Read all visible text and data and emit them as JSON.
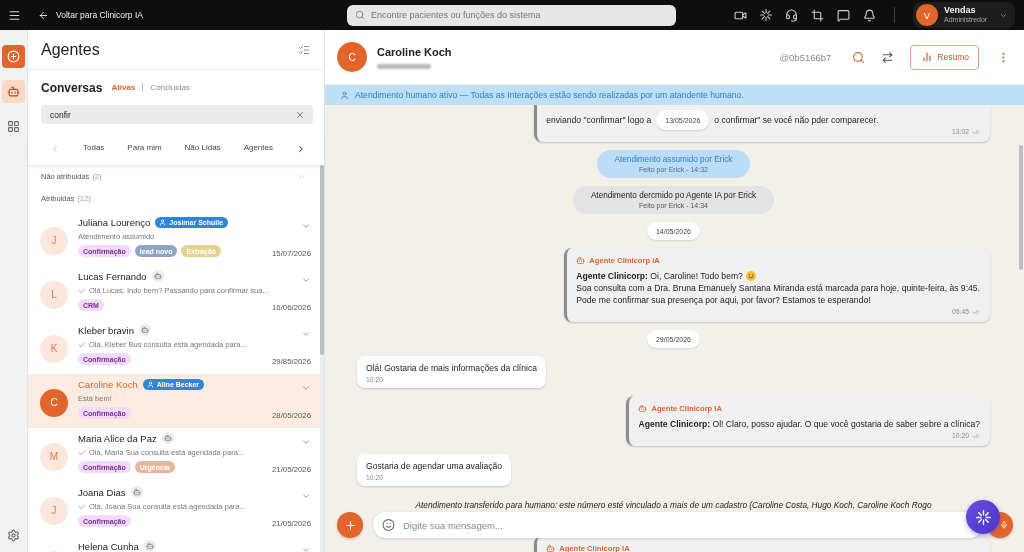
{
  "topbar": {
    "back_label": "Voltar para Clinicorp IA",
    "search": {
      "placeholder": "Encontre pacientes ou funções do sistema"
    },
    "user": {
      "initial": "V",
      "name": "Vendas",
      "role": "Administredor"
    }
  },
  "rail": {
    "nav": [
      {
        "kind": "agents",
        "selected": true
      },
      {
        "kind": "apps",
        "selected": false
      }
    ]
  },
  "panel": {
    "title": "Agentes",
    "section": "Conversas",
    "status_filters": [
      {
        "label": "Ativas",
        "selected": true
      },
      {
        "label": "Concluidas",
        "selected": false
      }
    ],
    "search": {
      "value": "confir"
    },
    "pager": {
      "prev_disabled": true,
      "next_disabled": false
    },
    "tabs": [
      {
        "label": "Todas",
        "selected": false
      },
      {
        "label": "Para mim",
        "selected": false
      },
      {
        "label": "Não Lidas",
        "selected": false
      },
      {
        "label": "Agentes",
        "selected": false
      }
    ],
    "groups": [
      {
        "label": "Não atribuidas",
        "count": "(2)",
        "collapsed": true
      },
      {
        "label": "Atribuidas",
        "count": "(12)"
      }
    ],
    "conversations": [
      {
        "initial": "J",
        "name": "Juliana Lourenço",
        "assignee": "Josimar Schulle",
        "preview": "Atendimento assumido",
        "sent": false,
        "tags": [
          {
            "label": "Confirmação",
            "color": "#f1dcf8"
          },
          {
            "label": "lead novo",
            "color": "#8ca4c6"
          },
          {
            "label": "Extração",
            "color": "#e2d48c"
          }
        ],
        "date": "15/07/2026",
        "selected": false
      },
      {
        "initial": "L",
        "name": "Lucas Fernando",
        "preview": "Olá Lucas, Indo bem? Passando para confirmar sua...",
        "sent": true,
        "tags": [
          {
            "label": "CRM",
            "color": "#f1dcf8"
          }
        ],
        "date": "16/06/2026",
        "selected": false
      },
      {
        "initial": "K",
        "name": "Kleber bravin",
        "preview": "Olá, Kleber Bus consulta está agendada para...",
        "sent": true,
        "tags": [
          {
            "label": "Confirmação",
            "color": "#f1dcf8"
          }
        ],
        "date": "29/85/2026",
        "selected": false
      },
      {
        "initial": "C",
        "name": "Caroline Koch",
        "assignee": "Aline Becker",
        "preview": "Está bem!",
        "sent": false,
        "tags": [
          {
            "label": "Confirmação",
            "color": "#f1dcf8"
          }
        ],
        "date": "28/05/2026",
        "selected": true
      },
      {
        "initial": "M",
        "name": "Maria Alice da Paz",
        "preview": "Olá, Maria Sua consulta está agendada para...",
        "sent": true,
        "tags": [
          {
            "label": "Confirmação",
            "color": "#f1dcf8"
          },
          {
            "label": "Urgência",
            "color": "#e8b59d"
          }
        ],
        "date": "21/05/2026",
        "selected": false
      },
      {
        "initial": "J",
        "name": "Joana Dias",
        "preview": "Olá, Joana Sua consulta está agendada para...",
        "sent": true,
        "tags": [
          {
            "label": "Confirmação",
            "color": "#f1dcf8"
          }
        ],
        "date": "21/05/2026",
        "selected": false
      },
      {
        "name": "Helena Cunha",
        "selected": false
      }
    ]
  },
  "chat": {
    "contact": {
      "initial": "C",
      "name": "Caroline Koch"
    },
    "handle": "@0b5166b7",
    "summary_button": "Resumo",
    "banner": "Atendimento humano ativo — Todas as Interações estão sendo realizadas por um atandente humano.",
    "sticky_date": "13/05/2026",
    "messages": [
      {
        "kind": "outgoing",
        "parts": [
          "enviando \"confirmar\" logo a",
          "o confirmar\" se você não pder comparecer."
        ],
        "time": "13:02"
      },
      {
        "kind": "event",
        "text": "Atendimento assumido por Erick",
        "meta": "Feito por Erick - 14:32",
        "highlight": true
      },
      {
        "kind": "event",
        "text": "Atendimento dercmido po Agente IA por Erick",
        "meta": "Feito por Erick - 14:34",
        "highlight": false
      },
      {
        "kind": "date",
        "text": "14/05/2026"
      },
      {
        "kind": "agent",
        "sender": "Agente Clinicorp IA",
        "lines": [
          {
            "text": "**Agente Clinicorp:** Oi, Caroline! Todo bem?",
            "emoji": true
          },
          {
            "text": "Soa consulta com a Dra. Bruna Emanuely Santana Miranda está marcada para hoje, quinte-feira, às 9:45."
          },
          {
            "text": "Pode me confirmar sua presença por aqui, por favor? Estamos te esperando!"
          }
        ],
        "time": "05:45"
      },
      {
        "kind": "date",
        "text": "29/05/2026"
      },
      {
        "kind": "incoming",
        "text": "Olá! Gostaria de mais informações da clínica",
        "time": "10:20"
      },
      {
        "kind": "agent",
        "sender": "Agente Clinicorp IA",
        "lines": [
          {
            "text": "**Agente Clinicorp:** Ol! Claro, posso ajudar. O que você gostaria de saber sebre a clínica?"
          }
        ],
        "time": "10:20"
      },
      {
        "kind": "incoming",
        "text": "Gostaria de agendar uma avaliação",
        "time": "10:20"
      },
      {
        "kind": "note",
        "text": "Atendimento transferido para humano: este número esté vinculado a mais de um cadastro (Caroline Costa, Hugo Koch, Caroline Koch Rogo"
      },
      {
        "kind": "agent",
        "sender": "Agente Clinicorp IA"
      }
    ],
    "composer": {
      "placeholder": "Digite sua mensagem..."
    }
  }
}
